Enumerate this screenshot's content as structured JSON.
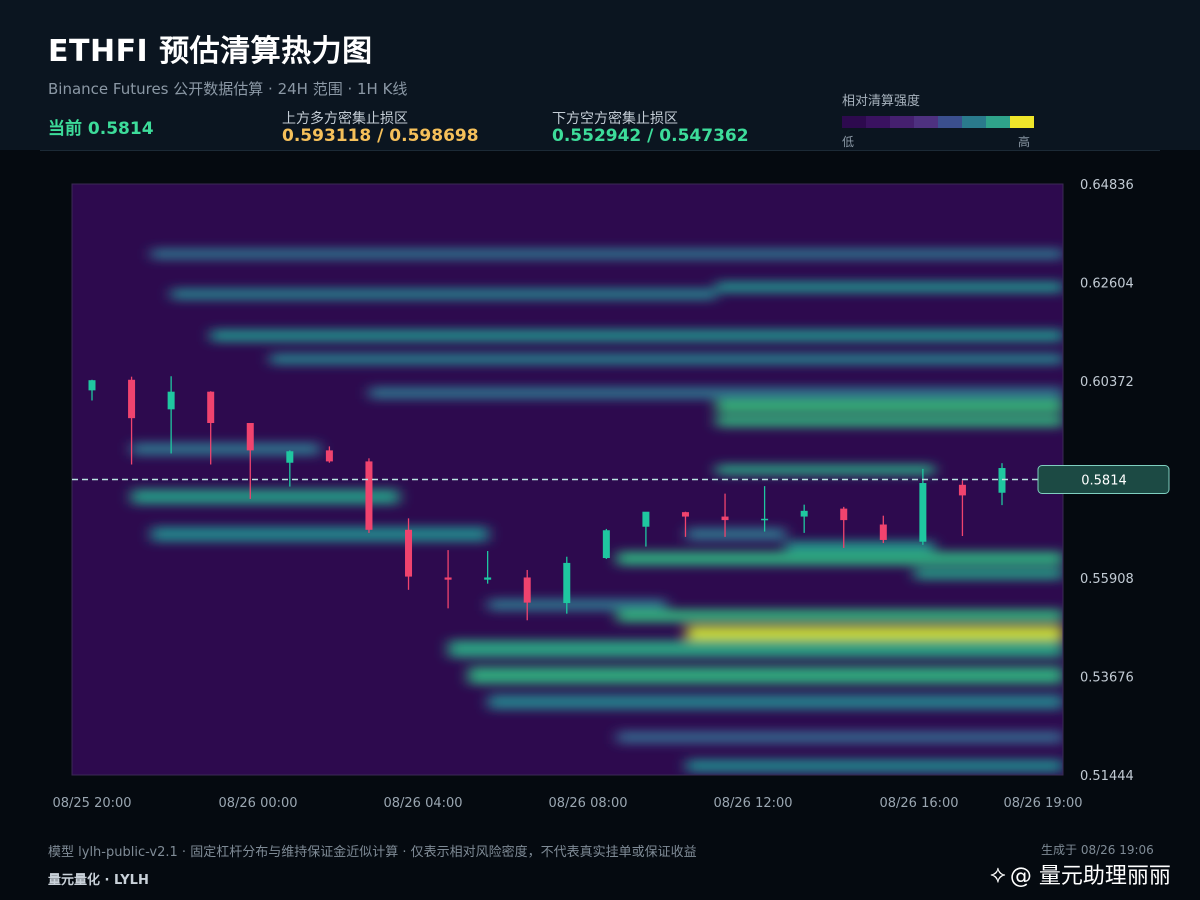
{
  "header": {
    "title": "ETHFI 预估清算热力图",
    "subtitle": "Binance Futures 公开数据估算 · 24H 范围 · 1H K线",
    "current_label": "当前 0.5814",
    "upper_zone_label": "上方多方密集止损区",
    "upper_zone_value": "0.593118 / 0.598698",
    "lower_zone_label": "下方空方密集止损区",
    "lower_zone_value": "0.552942 / 0.547362"
  },
  "legend": {
    "title": "相对清算强度",
    "low": "低",
    "high": "高",
    "colors": [
      "#2d0a4e",
      "#3a1260",
      "#45206f",
      "#4e3180",
      "#3b4f8e",
      "#2a7a8c",
      "#2fa38a",
      "#f0e62a"
    ]
  },
  "footer": {
    "note": "模型 lylh-public-v2.1 · 固定杠杆分布与维持保证金近似计算 · 仅表示相对风险密度，不代表真实挂单或保证收益",
    "brand": "量元量化 · LYLH",
    "generated": "生成于 08/26 19:06",
    "watermark_icon": "binance-square-icon",
    "watermark": "@ 量元助理丽丽"
  },
  "colors": {
    "up": "#1fc7a0",
    "down": "#f0436e",
    "price_line": "#b7e3e0",
    "badge_bg": "#1c4a44",
    "badge_border": "#7fcfc0"
  },
  "chart_data": {
    "type": "heatmap",
    "overlay": "candlestick",
    "y_axis_ticks": [
      "0.64836",
      "0.62604",
      "0.60372",
      "0.58140",
      "0.55908",
      "0.53676",
      "0.51444"
    ],
    "y_axis_labels": [
      "0.64836",
      "0.62604",
      "0.60372",
      "",
      "0.55908",
      "0.53676",
      "0.51444"
    ],
    "ylim": [
      0.51444,
      0.64836
    ],
    "x_axis_labels": [
      "08/25 20:00",
      "08/26 00:00",
      "08/26 04:00",
      "08/26 08:00",
      "08/26 12:00",
      "08/26 16:00",
      "08/26 19:00"
    ],
    "current_price": 0.5814,
    "current_price_label": "0.5814",
    "candles": [
      {
        "o": 0.6016,
        "h": 0.604,
        "l": 0.5993,
        "c": 0.6039
      },
      {
        "o": 0.604,
        "h": 0.6047,
        "l": 0.5848,
        "c": 0.5953
      },
      {
        "o": 0.5973,
        "h": 0.6048,
        "l": 0.5873,
        "c": 0.6013
      },
      {
        "o": 0.6013,
        "h": 0.6014,
        "l": 0.5848,
        "c": 0.5942
      },
      {
        "o": 0.5942,
        "h": 0.5942,
        "l": 0.577,
        "c": 0.588
      },
      {
        "o": 0.5852,
        "h": 0.588,
        "l": 0.5798,
        "c": 0.5878
      },
      {
        "o": 0.588,
        "h": 0.5889,
        "l": 0.5852,
        "c": 0.5855
      },
      {
        "o": 0.5855,
        "h": 0.5862,
        "l": 0.5693,
        "c": 0.57
      },
      {
        "o": 0.57,
        "h": 0.5726,
        "l": 0.5564,
        "c": 0.5594
      },
      {
        "o": 0.5592,
        "h": 0.5654,
        "l": 0.5522,
        "c": 0.5587
      },
      {
        "o": 0.5587,
        "h": 0.5652,
        "l": 0.5578,
        "c": 0.5592
      },
      {
        "o": 0.5592,
        "h": 0.5609,
        "l": 0.5495,
        "c": 0.5535
      },
      {
        "o": 0.5534,
        "h": 0.5639,
        "l": 0.551,
        "c": 0.5625
      },
      {
        "o": 0.5636,
        "h": 0.5702,
        "l": 0.5634,
        "c": 0.5699
      },
      {
        "o": 0.5707,
        "h": 0.571,
        "l": 0.5662,
        "c": 0.5741
      },
      {
        "o": 0.574,
        "h": 0.5741,
        "l": 0.5684,
        "c": 0.573
      },
      {
        "o": 0.573,
        "h": 0.5782,
        "l": 0.5684,
        "c": 0.5722
      },
      {
        "o": 0.5724,
        "h": 0.5799,
        "l": 0.5696,
        "c": 0.5725
      },
      {
        "o": 0.573,
        "h": 0.5757,
        "l": 0.5693,
        "c": 0.5743
      },
      {
        "o": 0.5748,
        "h": 0.5752,
        "l": 0.5659,
        "c": 0.5722
      },
      {
        "o": 0.5712,
        "h": 0.5732,
        "l": 0.567,
        "c": 0.5677
      },
      {
        "o": 0.5673,
        "h": 0.5838,
        "l": 0.5666,
        "c": 0.5806
      },
      {
        "o": 0.5802,
        "h": 0.5812,
        "l": 0.5686,
        "c": 0.5778
      },
      {
        "o": 0.5784,
        "h": 0.5851,
        "l": 0.5756,
        "c": 0.584
      }
    ],
    "bands": [
      {
        "y": 0.6325,
        "x_start": 0.08,
        "x_end": 1.0,
        "intensity": 0.35,
        "width": 0.0025
      },
      {
        "y": 0.6234,
        "x_start": 0.1,
        "x_end": 0.65,
        "intensity": 0.4,
        "width": 0.0026
      },
      {
        "y": 0.625,
        "x_start": 0.65,
        "x_end": 1.0,
        "intensity": 0.45,
        "width": 0.0026
      },
      {
        "y": 0.614,
        "x_start": 0.14,
        "x_end": 1.0,
        "intensity": 0.45,
        "width": 0.0028
      },
      {
        "y": 0.6087,
        "x_start": 0.2,
        "x_end": 1.0,
        "intensity": 0.4,
        "width": 0.0026
      },
      {
        "y": 0.601,
        "x_start": 0.3,
        "x_end": 1.0,
        "intensity": 0.35,
        "width": 0.0028
      },
      {
        "y": 0.598,
        "x_start": 0.65,
        "x_end": 1.0,
        "intensity": 0.65,
        "width": 0.003
      },
      {
        "y": 0.5946,
        "x_start": 0.65,
        "x_end": 1.0,
        "intensity": 0.62,
        "width": 0.0026
      },
      {
        "y": 0.5883,
        "x_start": 0.06,
        "x_end": 0.25,
        "intensity": 0.35,
        "width": 0.003
      },
      {
        "y": 0.5836,
        "x_start": 0.65,
        "x_end": 0.87,
        "intensity": 0.55,
        "width": 0.0024
      },
      {
        "y": 0.5775,
        "x_start": 0.06,
        "x_end": 0.33,
        "intensity": 0.5,
        "width": 0.0035
      },
      {
        "y": 0.569,
        "x_start": 0.08,
        "x_end": 0.42,
        "intensity": 0.42,
        "width": 0.0035
      },
      {
        "y": 0.569,
        "x_start": 0.62,
        "x_end": 0.72,
        "intensity": 0.35,
        "width": 0.003
      },
      {
        "y": 0.566,
        "x_start": 0.72,
        "x_end": 0.87,
        "intensity": 0.45,
        "width": 0.003
      },
      {
        "y": 0.5635,
        "x_start": 0.55,
        "x_end": 1.0,
        "intensity": 0.6,
        "width": 0.0032
      },
      {
        "y": 0.56,
        "x_start": 0.85,
        "x_end": 1.0,
        "intensity": 0.5,
        "width": 0.0026
      },
      {
        "y": 0.553,
        "x_start": 0.42,
        "x_end": 0.6,
        "intensity": 0.35,
        "width": 0.0028
      },
      {
        "y": 0.5505,
        "x_start": 0.55,
        "x_end": 1.0,
        "intensity": 0.62,
        "width": 0.003
      },
      {
        "y": 0.5465,
        "x_start": 0.62,
        "x_end": 1.0,
        "intensity": 0.95,
        "width": 0.0035
      },
      {
        "y": 0.543,
        "x_start": 0.38,
        "x_end": 1.0,
        "intensity": 0.55,
        "width": 0.004
      },
      {
        "y": 0.537,
        "x_start": 0.4,
        "x_end": 1.0,
        "intensity": 0.6,
        "width": 0.004
      },
      {
        "y": 0.531,
        "x_start": 0.42,
        "x_end": 1.0,
        "intensity": 0.4,
        "width": 0.0035
      },
      {
        "y": 0.523,
        "x_start": 0.55,
        "x_end": 1.0,
        "intensity": 0.3,
        "width": 0.003
      },
      {
        "y": 0.5165,
        "x_start": 0.62,
        "x_end": 1.0,
        "intensity": 0.42,
        "width": 0.003
      }
    ]
  }
}
